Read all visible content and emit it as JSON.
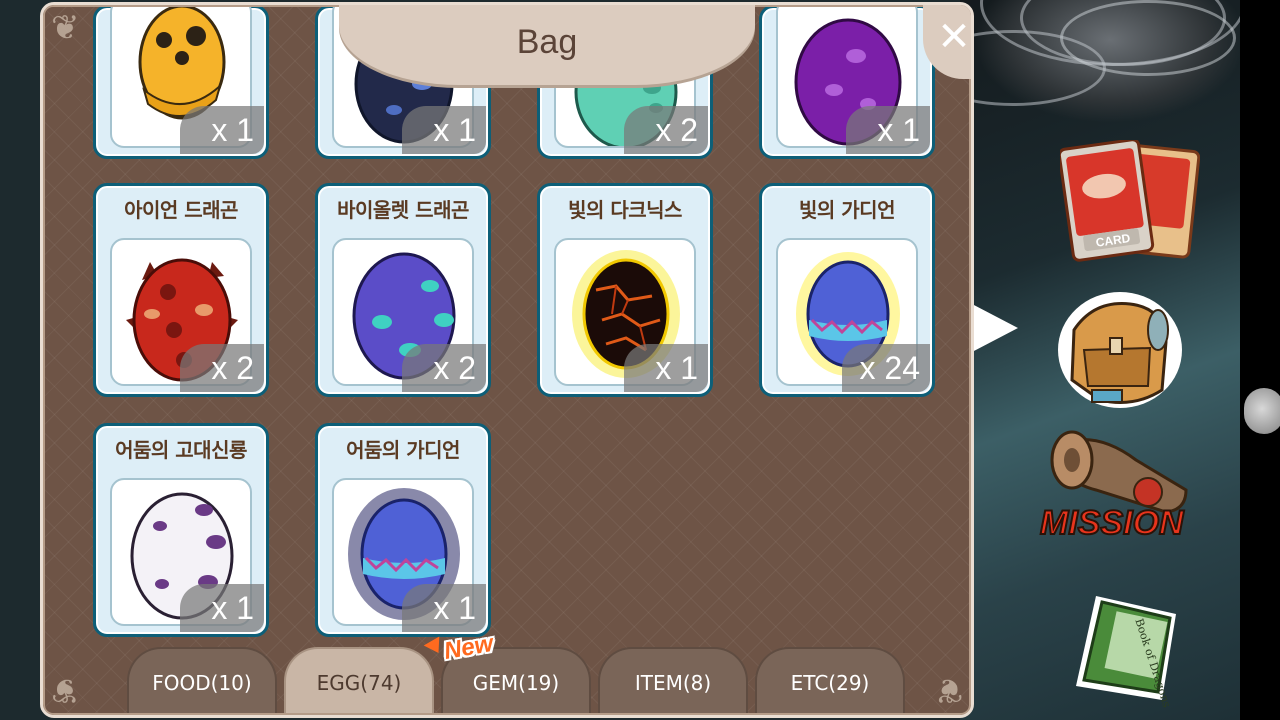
{
  "panel": {
    "title": "Bag",
    "close_icon": "close-icon"
  },
  "top_row": [
    {
      "qty": "x 1",
      "egg": "yellow-gold-egg"
    },
    {
      "qty": "x 1",
      "egg": "dark-blue-egg"
    },
    {
      "qty": "x 2",
      "egg": "teal-egg"
    },
    {
      "qty": "x 1",
      "egg": "purple-egg"
    }
  ],
  "eggs": [
    {
      "name": "아이언 드래곤",
      "qty": "x 2",
      "egg": "red-spiked-egg"
    },
    {
      "name": "바이올렛 드래곤",
      "qty": "x 2",
      "egg": "violet-spotted-egg"
    },
    {
      "name": "빛의 다크닉스",
      "qty": "x 1",
      "egg": "lava-glow-egg"
    },
    {
      "name": "빛의 가디언",
      "qty": "x 24",
      "egg": "blue-glow-egg"
    },
    {
      "name": "어둠의 고대신룡",
      "qty": "x 1",
      "egg": "white-spotted-egg"
    },
    {
      "name": "어둠의 가디언",
      "qty": "x 1",
      "egg": "blue-dark-egg"
    }
  ],
  "tabs": [
    {
      "label": "FOOD(10)",
      "active": false
    },
    {
      "label": "EGG(74)",
      "active": true
    },
    {
      "label": "GEM(19)",
      "active": false
    },
    {
      "label": "ITEM(8)",
      "active": false
    },
    {
      "label": "ETC(29)",
      "active": false
    }
  ],
  "new_badge": "New",
  "side_menu": {
    "card_label": "CARD",
    "mission_label": "MISSION",
    "book_label": "Book of Dragons"
  },
  "colors": {
    "panel_bg": "#6e5446",
    "card_border": "#0d5f78",
    "tab_active": "#c9b6a6",
    "new_badge": "#ff6a1f"
  }
}
